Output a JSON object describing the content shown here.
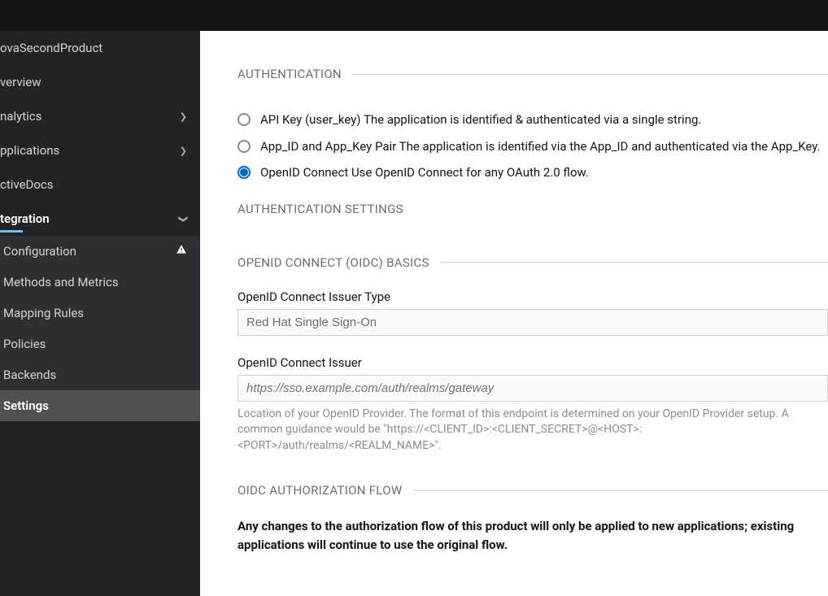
{
  "sidebar": {
    "product_name": "ovaSecondProduct",
    "items": [
      {
        "label": "verview",
        "expandable": false
      },
      {
        "label": "nalytics",
        "expandable": true
      },
      {
        "label": "pplications",
        "expandable": true
      },
      {
        "label": "ctiveDocs",
        "expandable": false
      },
      {
        "label": "tegration",
        "expandable": true,
        "expanded": true
      }
    ],
    "integration_subitems": [
      {
        "label": "Configuration",
        "warning": true
      },
      {
        "label": "Methods and Metrics"
      },
      {
        "label": "Mapping Rules"
      },
      {
        "label": "Policies"
      },
      {
        "label": "Backends"
      },
      {
        "label": "Settings",
        "active": true
      }
    ]
  },
  "main": {
    "authentication": {
      "heading": "AUTHENTICATION",
      "options": [
        {
          "label": "API Key (user_key) The application is identified & authenticated via a single string.",
          "selected": false
        },
        {
          "label": "App_ID and App_Key Pair The application is identified via the App_ID and authenticated via the App_Key.",
          "selected": false
        },
        {
          "label": "OpenID Connect Use OpenID Connect for any OAuth 2.0 flow.",
          "selected": true
        }
      ]
    },
    "auth_settings_heading": "AUTHENTICATION SETTINGS",
    "oidc_basics": {
      "heading": "OPENID CONNECT (OIDC) BASICS",
      "issuer_type_label": "OpenID Connect Issuer Type",
      "issuer_type_value": "Red Hat Single Sign-On",
      "issuer_label": "OpenID Connect Issuer",
      "issuer_placeholder": "https://sso.example.com/auth/realms/gateway",
      "issuer_help": "Location of your OpenID Provider. The format of this endpoint is determined on your OpenID Provider setup. A common guidance would be \"https://<CLIENT_ID>:<CLIENT_SECRET>@<HOST>:<PORT>/auth/realms/<REALM_NAME>\"."
    },
    "oidc_flow": {
      "heading": "OIDC AUTHORIZATION FLOW",
      "warning": "Any changes to the authorization flow of this product will only be applied to new applications; existing applications will continue to use the original flow."
    }
  }
}
